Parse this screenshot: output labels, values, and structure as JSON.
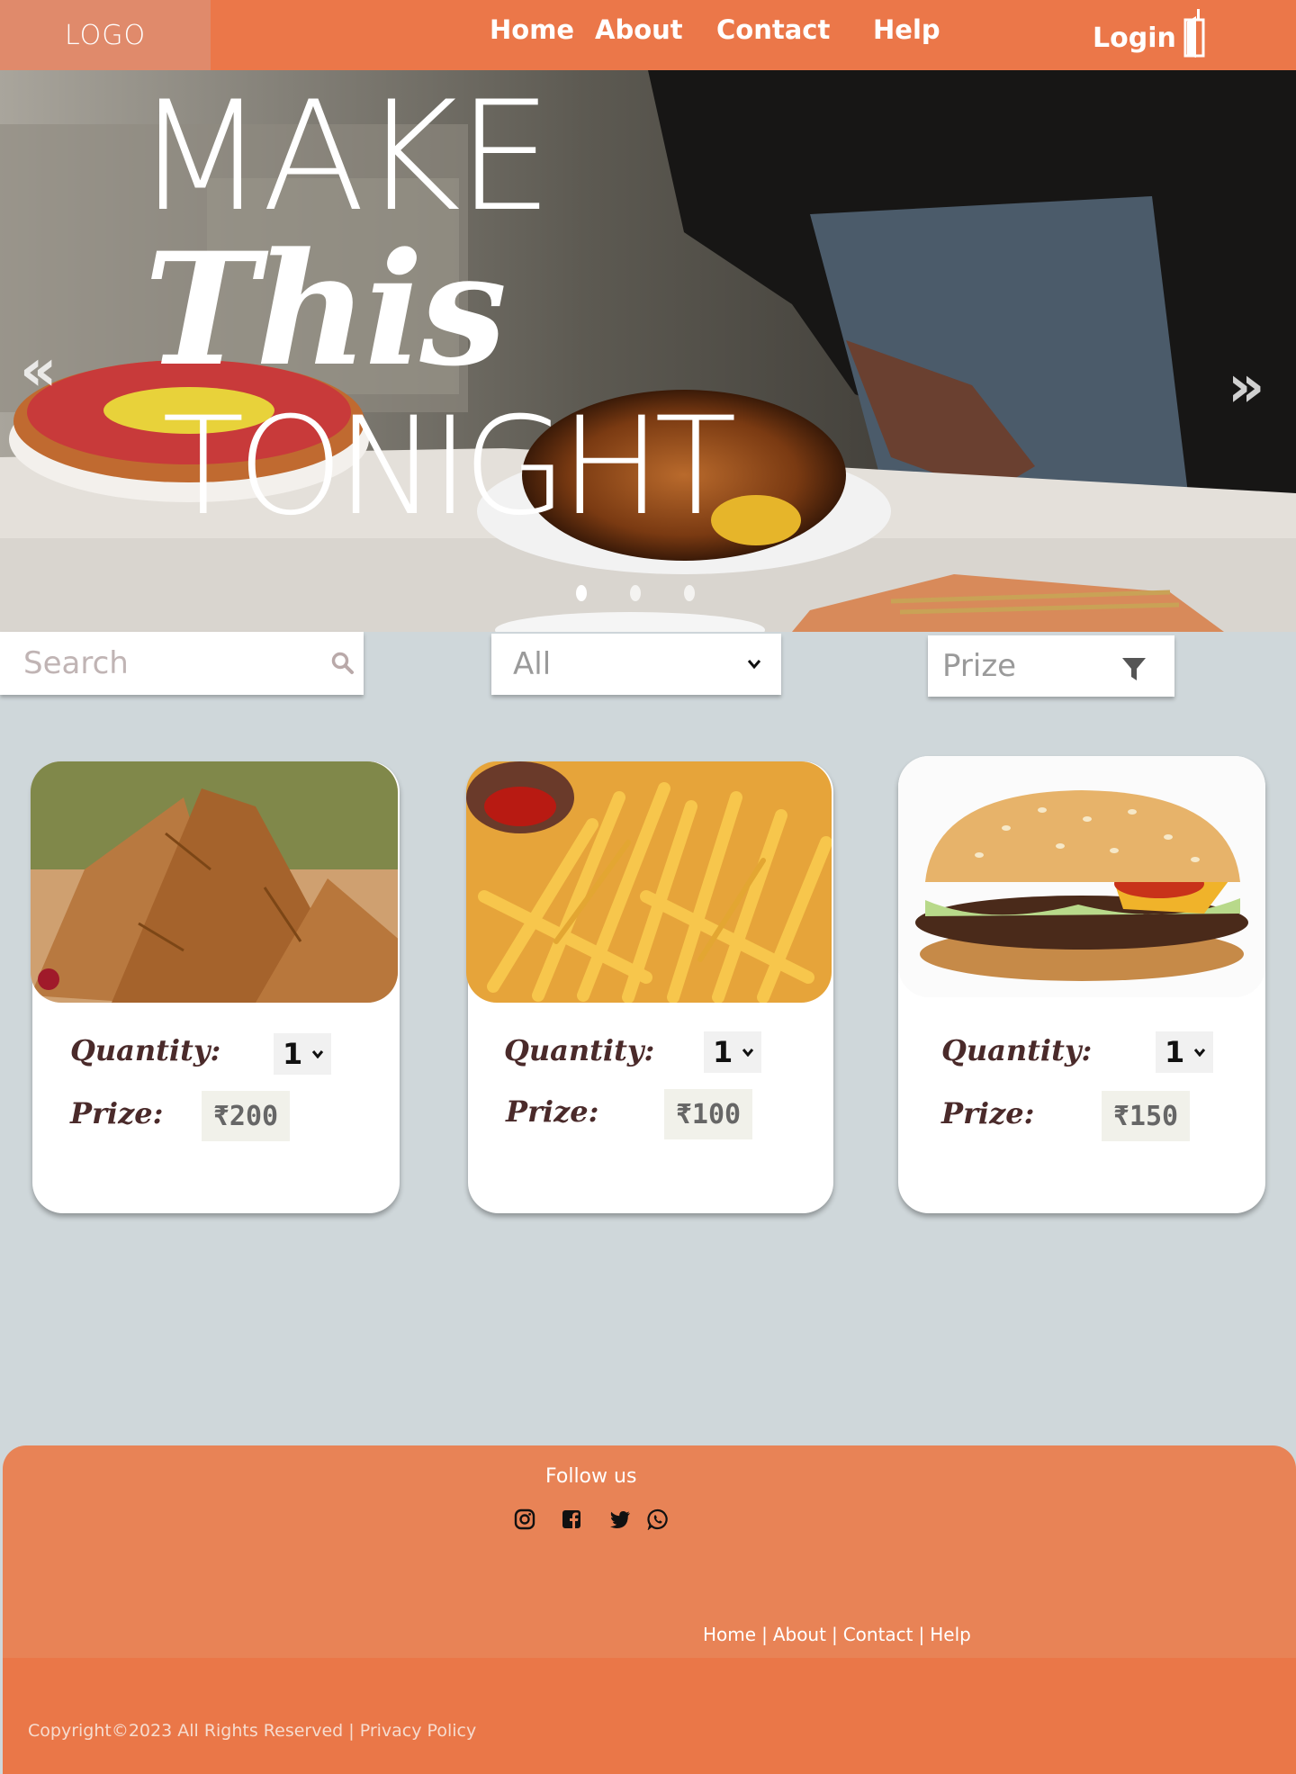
{
  "nav": {
    "logo": "LOGO",
    "links": [
      "Home",
      "About",
      "Contact",
      "Help"
    ],
    "login": "Login"
  },
  "hero": {
    "line1": "MAKE",
    "line2": "This",
    "line3": "TONIGHT",
    "prev": "«",
    "next": "»",
    "slides": 3,
    "active_slide": 0
  },
  "filters": {
    "search_placeholder": "Search",
    "category": "All",
    "prize": "Prize"
  },
  "products": [
    {
      "name": "samosa",
      "quantity_label": "Quantity:",
      "quantity": "1",
      "prize_label": "Prize:",
      "price": "₹200"
    },
    {
      "name": "fries",
      "quantity_label": "Quantity:",
      "quantity": "1",
      "prize_label": "Prize:",
      "price": "₹100"
    },
    {
      "name": "burger",
      "quantity_label": "Quantity:",
      "quantity": "1",
      "prize_label": "Prize:",
      "price": "₹150"
    }
  ],
  "footer": {
    "follow": "Follow us",
    "social_icons": [
      "instagram-icon",
      "facebook-icon",
      "twitter-icon",
      "whatsapp-icon"
    ],
    "links": [
      "Home",
      "About",
      "Contact",
      "Help"
    ],
    "separator": "|",
    "copyright": "Copyright©2023 All Rights Reserved | Privacy Policy"
  },
  "colors": {
    "brand": "#eb7749",
    "page_bg": "#cfd7da",
    "text_dark": "#4a2a2a"
  }
}
